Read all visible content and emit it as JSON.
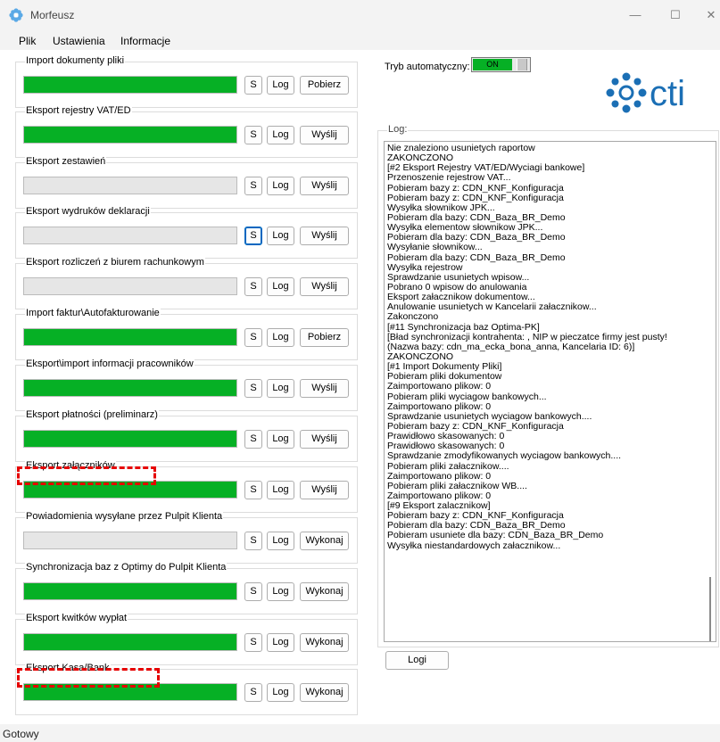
{
  "window": {
    "title": "Morfeusz",
    "minimize_glyph": "—",
    "maximize_glyph": "☐",
    "close_glyph": "✕",
    "icon": "gear-flower-icon"
  },
  "menu": {
    "items": [
      "Plik",
      "Ustawienia",
      "Informacje"
    ]
  },
  "groups": [
    {
      "label": "Import dokumenty pliki",
      "progress": 1.0,
      "s": "S",
      "log": "Log",
      "action": "Pobierz"
    },
    {
      "label": "Eksport rejestry VAT/ED",
      "progress": 1.0,
      "s": "S",
      "log": "Log",
      "action": "Wyślij"
    },
    {
      "label": "Eksport zestawień",
      "progress": 0.0,
      "s": "S",
      "log": "Log",
      "action": "Wyślij"
    },
    {
      "label": "Eksport wydruków deklaracji",
      "progress": 0.0,
      "s": "S",
      "log": "Log",
      "action": "Wyślij"
    },
    {
      "label": "Eksport rozliczeń z biurem rachunkowym",
      "progress": 0.0,
      "s": "S",
      "log": "Log",
      "action": "Wyślij"
    },
    {
      "label": "Import faktur\\Autofakturowanie",
      "progress": 1.0,
      "s": "S",
      "log": "Log",
      "action": "Pobierz"
    },
    {
      "label": "Eksport\\import informacji pracowników",
      "progress": 1.0,
      "s": "S",
      "log": "Log",
      "action": "Wyślij"
    },
    {
      "label": "Eksport płatności (preliminarz)",
      "progress": 1.0,
      "s": "S",
      "log": "Log",
      "action": "Wyślij"
    },
    {
      "label": "Eksport załączników",
      "progress": 1.0,
      "s": "S",
      "log": "Log",
      "action": "Wyślij"
    },
    {
      "label": "Powiadomienia wysyłane przez Pulpit Klienta",
      "progress": 0.0,
      "s": "S",
      "log": "Log",
      "action": "Wykonaj"
    },
    {
      "label": "Synchronizacja baz z Optimy do Pulpit Klienta",
      "progress": 1.0,
      "s": "S",
      "log": "Log",
      "action": "Wykonaj"
    },
    {
      "label": "Eksport kwitków wypłat",
      "progress": 1.0,
      "s": "S",
      "log": "Log",
      "action": "Wykonaj"
    },
    {
      "label": "Eksport Kasa/Bank",
      "progress": 1.0,
      "s": "S",
      "log": "Log",
      "action": "Wykonaj"
    }
  ],
  "auto_mode": {
    "label": "Tryb automatyczny:",
    "state": "ON"
  },
  "logo": {
    "text": "cti",
    "color": "#1b6fb5"
  },
  "log": {
    "caption": "Log:",
    "lines": [
      "Nie znaleziono usunietych raportow",
      "ZAKONCZONO",
      "[#2 Eksport Rejestry VAT/ED/Wyciagi bankowe]",
      "Przenoszenie rejestrow VAT...",
      "Pobieram bazy z: CDN_KNF_Konfiguracja",
      "Pobieram bazy z: CDN_KNF_Konfiguracja",
      "Wysyłka słownikow JPK...",
      "Pobieram dla bazy: CDN_Baza_BR_Demo",
      "Wysyłka elementow słownikow JPK...",
      "Pobieram dla bazy: CDN_Baza_BR_Demo",
      "Wysyłanie słownikow...",
      "Pobieram dla bazy: CDN_Baza_BR_Demo",
      "Wysyłka rejestrow",
      "Sprawdzanie usunietych wpisow...",
      "Pobrano 0 wpisow do anulowania",
      "Eksport załacznikow dokumentow...",
      "Anulowanie usunietych w Kancelarii załacznikow...",
      "Zakonczono",
      "[#11 Synchronizacja baz Optima-PK]",
      "[Bład synchronizacji kontrahenta: , NIP w pieczatce firmy jest pusty!",
      "(Nazwa bazy: cdn_ma_ecka_bona_anna, Kancelaria ID: 6)]",
      "ZAKONCZONO",
      "[#1 Import Dokumenty Pliki]",
      "Pobieram pliki dokumentow",
      "Zaimportowano plikow: 0",
      "Pobieram pliki wyciagow bankowych...",
      "Zaimportowano plikow: 0",
      "Sprawdzanie usunietych wyciagow bankowych....",
      "Pobieram bazy z: CDN_KNF_Konfiguracja",
      "Prawidłowo skasowanych: 0",
      "Prawidłowo skasowanych: 0",
      "Sprawdzanie zmodyfikowanych wyciagow bankowych....",
      "Pobieram pliki załacznikow....",
      "Zaimportowano plikow: 0",
      "Pobieram pliki załacznikow WB....",
      "Zaimportowano plikow: 0",
      "[#9 Eksport zalacznikow]",
      "Pobieram bazy z: CDN_KNF_Konfiguracja",
      "Pobieram dla bazy: CDN_Baza_BR_Demo",
      "Pobieram usuniete dla bazy: CDN_Baza_BR_Demo",
      "Wysyłka niestandardowych załacznikow..."
    ],
    "button": "Logi"
  },
  "status": {
    "text": "Gotowy"
  },
  "colors": {
    "progress": "#06b025",
    "empty_bar": "#e6e6e6",
    "annotation": "#e60000"
  }
}
